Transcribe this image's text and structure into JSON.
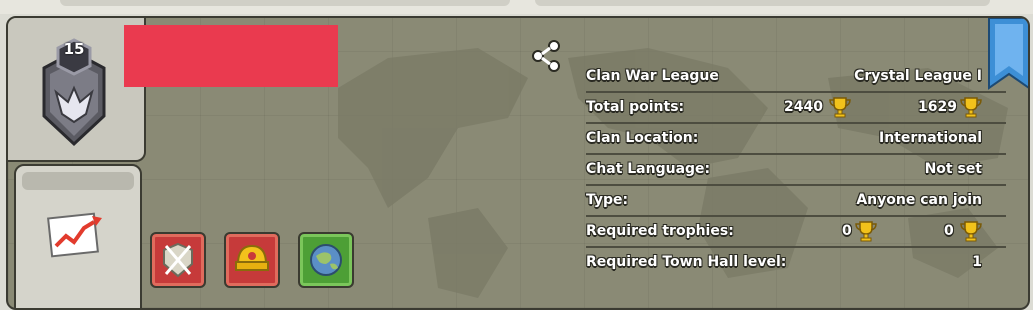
{
  "clan": {
    "level": "15",
    "name_redacted": true
  },
  "info_rows": {
    "war_league": {
      "label": "Clan War League",
      "value": "Crystal League I"
    },
    "total_points": {
      "label": "Total points:",
      "value_a": "2440",
      "value_b": "1629"
    },
    "location": {
      "label": "Clan Location:",
      "value": "International"
    },
    "chat_language": {
      "label": "Chat Language:",
      "value": "Not set"
    },
    "type": {
      "label": "Type:",
      "value": "Anyone can join"
    },
    "required_trophies": {
      "label": "Required trophies:",
      "value_a": "0",
      "value_b": "0"
    },
    "required_th": {
      "label": "Required Town Hall level:",
      "value": "1"
    }
  },
  "icons": {
    "share": "share-icon",
    "stats": "trending-chart-icon",
    "perk_1": "crossed-swords-shield-icon",
    "perk_2": "gold-helmet-icon",
    "perk_3": "globe-icon",
    "trophy": "trophy-icon",
    "bookmark": "bookmark-ribbon-icon"
  },
  "colors": {
    "redaction": "#ea3a4f",
    "panel": "#8a8a75",
    "trophy": "#f2c21b",
    "ribbon": "#3d8fd6"
  }
}
